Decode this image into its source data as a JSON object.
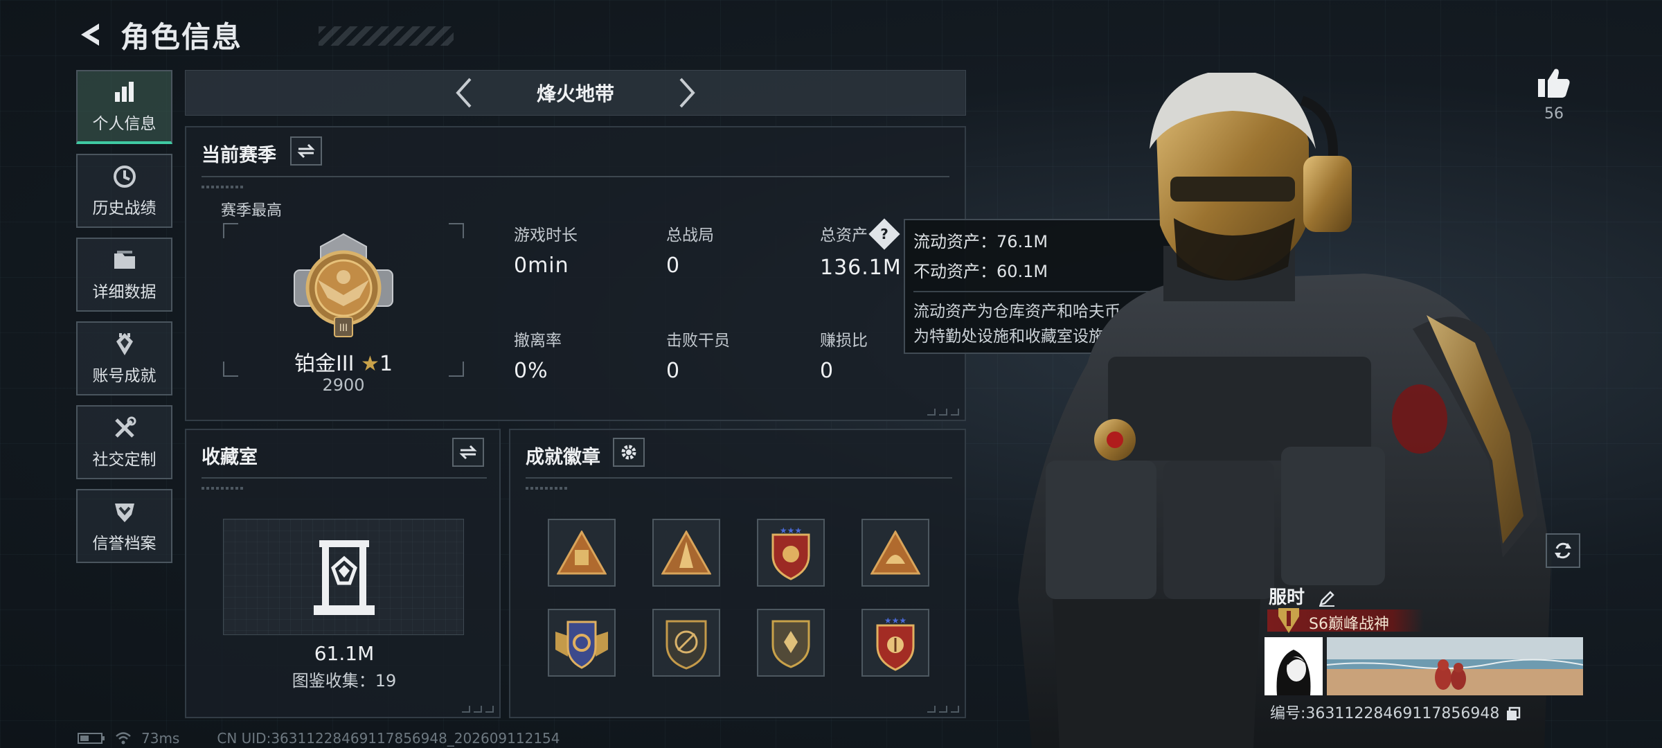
{
  "header": {
    "title": "角色信息"
  },
  "sidebar": {
    "items": [
      {
        "label": "个人信息",
        "icon": "bar-chart-icon",
        "active": true
      },
      {
        "label": "历史战绩",
        "icon": "clock-icon",
        "active": false
      },
      {
        "label": "详细数据",
        "icon": "folder-icon",
        "active": false
      },
      {
        "label": "账号成就",
        "icon": "medal-icon",
        "active": false
      },
      {
        "label": "社交定制",
        "icon": "tools-icon",
        "active": false
      },
      {
        "label": "信誉档案",
        "icon": "shield-icon",
        "active": false
      }
    ]
  },
  "mode": {
    "title": "烽火地带"
  },
  "season": {
    "title": "当前赛季",
    "best_label": "赛季最高",
    "rank_name": "铂金III",
    "rank_stars": "1",
    "rank_score": "2900",
    "stats": [
      {
        "label": "游戏时长",
        "value": "0min"
      },
      {
        "label": "总战局",
        "value": "0"
      },
      {
        "label": "总资产",
        "value": "136.1M"
      },
      {
        "label": "撤离率",
        "value": "0%"
      },
      {
        "label": "击败干员",
        "value": "0"
      },
      {
        "label": "赚损比",
        "value": "0"
      }
    ],
    "help_symbol": "?"
  },
  "tooltip": {
    "liquid": "流动资产：76.1M",
    "fixed": "不动资产：60.1M",
    "desc_line1": "流动资产为仓库资产和哈夫币，不动资产",
    "desc_line2": "为特勤处设施和收藏室设施"
  },
  "collection": {
    "title": "收藏室",
    "value": "61.1M",
    "count": "图鉴收集：19"
  },
  "badges": {
    "title": "成就徽章",
    "items": [
      "triangle-emblem-badge",
      "triangle-tower-badge",
      "star-shield-badge",
      "triangle-helmet-badge",
      "winged-shield-badge",
      "round-shield-badge",
      "crest-shield-badge",
      "star-crest-badge"
    ]
  },
  "likes": {
    "count": "56"
  },
  "card": {
    "name": "服时",
    "title_tag": "S6巅峰战神",
    "id_text": "编号:3631122846911785694​8"
  },
  "status": {
    "ping": "73ms",
    "uid": "CN UID:36311228469117856948_202609112154"
  },
  "colors": {
    "accent": "#3fc9a2",
    "panel_border": "#323c45",
    "tag_red": "#7a1c1c",
    "gold": "#c9a24a"
  }
}
